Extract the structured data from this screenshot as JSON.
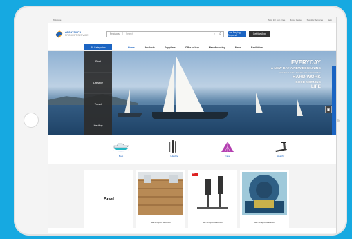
{
  "colors": {
    "background": "#16a9e1",
    "brand_blue": "#1b64c2",
    "menu_dark": "#2d2d2d"
  },
  "topbar": {
    "left": "Welcome",
    "right": [
      "Sign In / Join Free",
      "Buyer Center",
      "Supplier Services",
      "Help"
    ]
  },
  "logo": {
    "name": "ABOUTSHIPS",
    "sub": "PRODUCT SERVICE"
  },
  "search": {
    "category": "Products",
    "placeholder": "Search"
  },
  "header_buttons": {
    "post": "Post Buying Request",
    "app": "Get the App"
  },
  "nav": {
    "categories_label": "All Categories",
    "links": [
      {
        "label": "Home",
        "active": true
      },
      {
        "label": "Products"
      },
      {
        "label": "Suppliers"
      },
      {
        "label": "Offer to buy"
      },
      {
        "label": "Manufacturing"
      },
      {
        "label": "News"
      },
      {
        "label": "Exhibition"
      }
    ]
  },
  "category_menu": [
    "Boat",
    "Lifestyle",
    "Travel",
    "Healthy"
  ],
  "slogan": {
    "l1": "EVERYDAY",
    "l2": "A NEW DAY  A NEW BEGINNING",
    "l3": "YOUTH IS STILL THERE  YOU ARE YOUNG",
    "l4": "HARD WORK",
    "l5": "GOOD MORNING",
    "l6": "LIFE"
  },
  "icon_categories": [
    {
      "label": "Boat",
      "icon": "boat-icon"
    },
    {
      "label": "Lifestyle",
      "icon": "paddle-board-icon"
    },
    {
      "label": "Travel",
      "icon": "tent-icon"
    },
    {
      "label": "Healthy",
      "icon": "treadmill-icon"
    }
  ],
  "products": {
    "first_card": "Boat",
    "items": [
      {
        "caption": "HE-10 Epro Stabilizer"
      },
      {
        "caption": "HE-10 Epro Stabilizer"
      },
      {
        "caption": "HE-10 Epro Stabilizer"
      }
    ],
    "badge": "EZ"
  }
}
